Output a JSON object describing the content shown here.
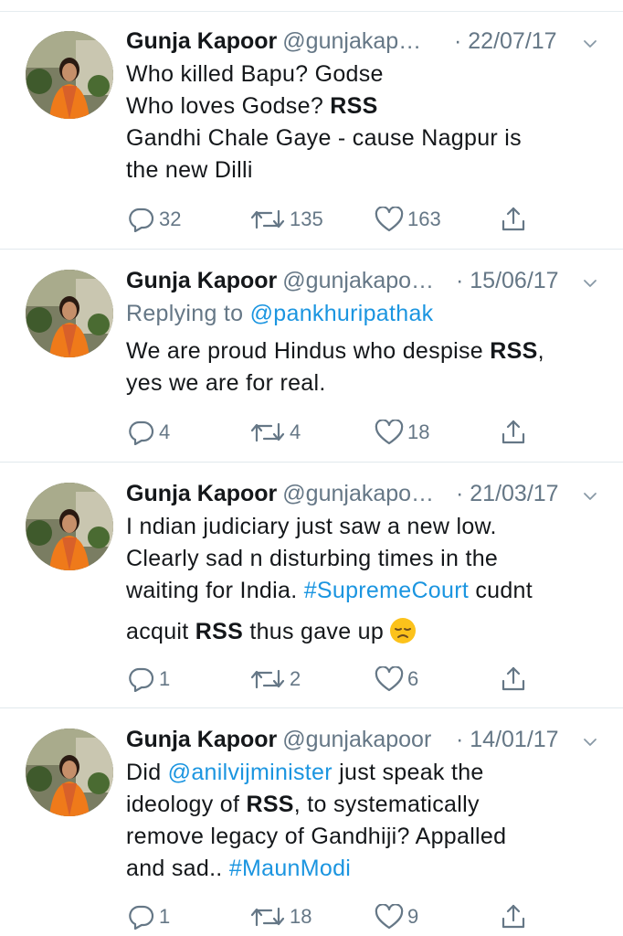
{
  "tweets": [
    {
      "name": "Gunja Kapoor",
      "handle": "@gunjakap…",
      "date": "· 22/07/17",
      "lines": [
        [
          {
            "t": "Who killed Bapu? Godse"
          }
        ],
        [
          {
            "t": "Who loves Godse? "
          },
          {
            "t": "RSS",
            "s": "bold"
          }
        ],
        [
          {
            "t": "Gandhi Chale Gaye - cause Nagpur is"
          }
        ],
        [
          {
            "t": "the new Dilli"
          }
        ]
      ],
      "replies": "32",
      "retweets": "135",
      "likes": "163"
    },
    {
      "name": "Gunja Kapoor",
      "handle": "@gunjakapo…",
      "date": "· 15/06/17",
      "replying_prefix": "Replying to ",
      "replying_to": "@pankhuripathak",
      "lines": [
        [
          {
            "t": "We are proud Hindus who despise "
          },
          {
            "t": "RSS",
            "s": "bold"
          },
          {
            "t": ","
          }
        ],
        [
          {
            "t": "yes we are for real."
          }
        ]
      ],
      "replies": "4",
      "retweets": "4",
      "likes": "18"
    },
    {
      "name": "Gunja Kapoor",
      "handle": "@gunjakapo…",
      "date": "· 21/03/17",
      "lines": [
        [
          {
            "t": "I ndian judiciary just saw a new low."
          }
        ],
        [
          {
            "t": "Clearly sad n disturbing times in the"
          }
        ],
        [
          {
            "t": "waiting for India. "
          },
          {
            "t": "#SupremeCourt",
            "s": "link"
          },
          {
            "t": " cudnt"
          }
        ],
        [
          {
            "t": "acquit "
          },
          {
            "t": "RSS",
            "s": "bold"
          },
          {
            "t": " thus gave up"
          }
        ]
      ],
      "emoji": "disappointed-face",
      "replies": "1",
      "retweets": "2",
      "likes": "6"
    },
    {
      "name": "Gunja Kapoor",
      "handle": "@gunjakapoor",
      "date": "· 14/01/17",
      "lines": [
        [
          {
            "t": "Did "
          },
          {
            "t": "@anilvijminister",
            "s": "link"
          },
          {
            "t": " just speak the"
          }
        ],
        [
          {
            "t": "ideology of "
          },
          {
            "t": "RSS",
            "s": "bold"
          },
          {
            "t": ", to systematically"
          }
        ],
        [
          {
            "t": "remove legacy of Gandhiji? Appalled"
          }
        ],
        [
          {
            "t": "and sad.. "
          },
          {
            "t": "#MaunModi",
            "s": "link"
          }
        ]
      ],
      "replies": "1",
      "retweets": "18",
      "likes": "9"
    }
  ],
  "colors": {
    "link": "#1b95e0",
    "muted": "#657786",
    "text": "#14171a",
    "divider": "#e1e8ed"
  },
  "icons": {
    "reply": "reply-icon",
    "retweet": "retweet-icon",
    "like": "heart-icon",
    "share": "share-icon",
    "caret": "chevron-down-icon"
  }
}
